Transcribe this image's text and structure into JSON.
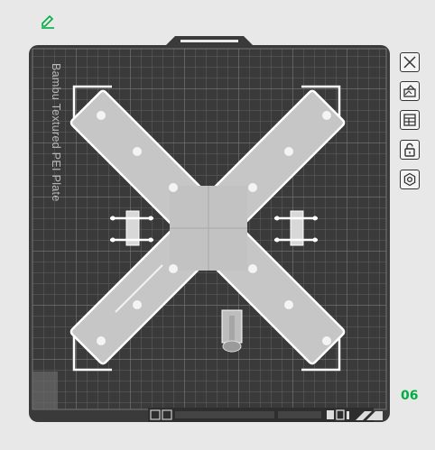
{
  "plate": {
    "name": "Bambu Textured PEI Plate",
    "number": "06"
  },
  "colors": {
    "background": "#e8e8e8",
    "plate": "#3a3a3a",
    "grid": "#5a5a5a",
    "accent": "#00ae42",
    "part": "#c4c4c4",
    "outline": "#ffffff"
  },
  "toolbar": {
    "buttons": [
      {
        "name": "close-plate",
        "icon": "close-icon"
      },
      {
        "name": "auto-orient",
        "icon": "orient-icon"
      },
      {
        "name": "arrange",
        "icon": "arrange-icon"
      },
      {
        "name": "lock-plate",
        "icon": "lock-icon"
      },
      {
        "name": "plate-settings",
        "icon": "gear-icon"
      }
    ]
  }
}
